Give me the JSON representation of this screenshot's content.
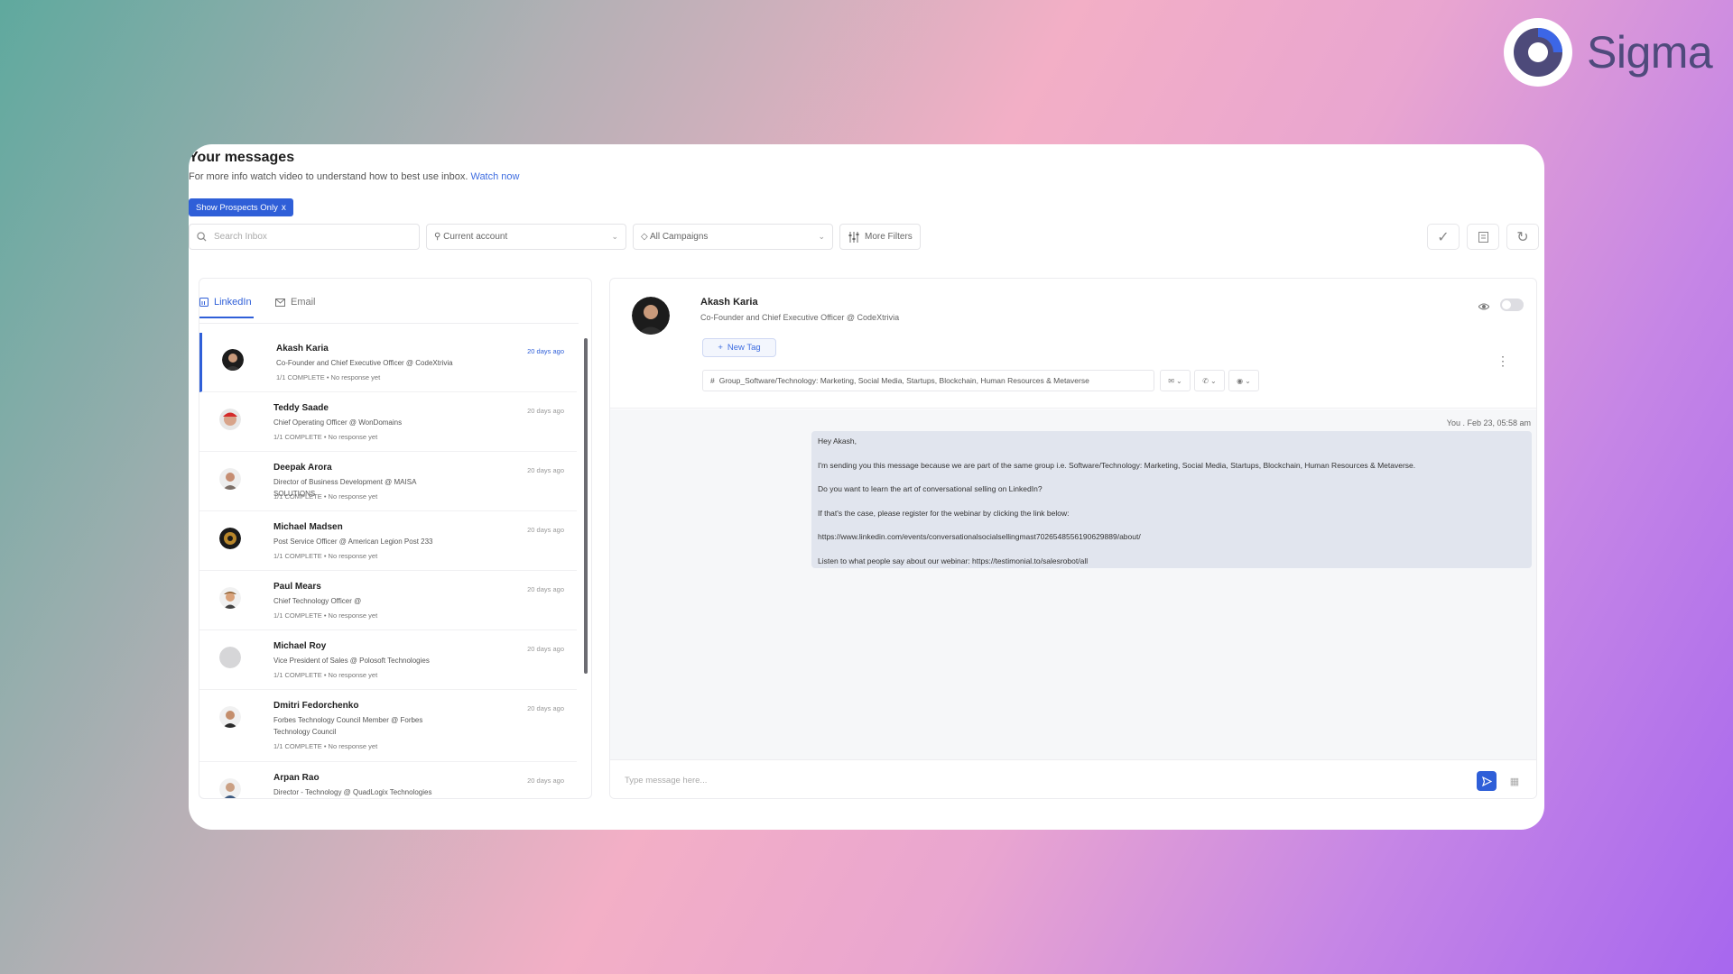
{
  "brand": {
    "name": "Sigma",
    "accent": "#2f5fd8"
  },
  "header": {
    "title": "Your messages",
    "subtitle": "For more info watch video to understand how to best use inbox.",
    "watch_link": "Watch now",
    "chip_label": "Show Prospects Only",
    "chip_close": "x"
  },
  "filters": {
    "search_placeholder": "Search Inbox",
    "account": "Current account",
    "campaign": "All Campaigns",
    "more_filters": "More Filters"
  },
  "tabs": [
    {
      "label": "LinkedIn",
      "active": true
    },
    {
      "label": "Email",
      "active": false
    }
  ],
  "conversations": [
    {
      "name": "Akash Karia",
      "title": "Co-Founder and Chief Executive Officer @ CodeXtrivia",
      "status": "1/1 COMPLETE • No response yet",
      "time": "20 days ago"
    },
    {
      "name": "Teddy Saade",
      "title": "Chief Operating Officer @ WonDomains",
      "status": "1/1 COMPLETE • No response yet",
      "time": "20 days ago"
    },
    {
      "name": "Deepak Arora",
      "title": "Director of Business Development @ MAISA SOLUTIONS",
      "status": "1/1 COMPLETE • No response yet",
      "time": "20 days ago"
    },
    {
      "name": "Michael Madsen",
      "title": "Post Service Officer @ American Legion Post 233",
      "status": "1/1 COMPLETE • No response yet",
      "time": "20 days ago"
    },
    {
      "name": "Paul Mears",
      "title": "Chief Technology Officer @",
      "status": "1/1 COMPLETE • No response yet",
      "time": "20 days ago"
    },
    {
      "name": "Michael Roy",
      "title": "Vice President of Sales @ Polosoft Technologies",
      "status": "1/1 COMPLETE • No response yet",
      "time": "20 days ago"
    },
    {
      "name": "Dmitri Fedorchenko",
      "title": "Forbes Technology Council Member @ Forbes Technology Council",
      "status": "1/1 COMPLETE • No response yet",
      "time": "20 days ago"
    },
    {
      "name": "Arpan Rao",
      "title": "Director - Technology @ QuadLogix Technologies",
      "status": "",
      "time": "20 days ago"
    }
  ],
  "contact": {
    "name": "Akash Karia",
    "title": "Co-Founder and Chief Executive Officer @ CodeXtrivia",
    "new_tag": "New Tag",
    "group_tag": "Group_Software/Technology: Marketing, Social Media, Startups, Blockchain, Human Resources & Metaverse"
  },
  "message": {
    "meta": "You . Feb 23, 05:58 am",
    "lines": [
      "Hey Akash,",
      "I'm sending you this message because we are part of the same group i.e. Software/Technology: Marketing, Social Media, Startups, Blockchain, Human Resources & Metaverse.",
      "Do you want to learn the art of conversational selling on LinkedIn?",
      "If that's the case, please register for the webinar by clicking the link below:",
      "https://www.linkedin.com/events/conversationalsocialsellingmast7026548556190629889/about/",
      "Listen to what people say about our webinar: https://testimonial.to/salesrobot/all"
    ]
  },
  "composer": {
    "placeholder": "Type message here..."
  }
}
